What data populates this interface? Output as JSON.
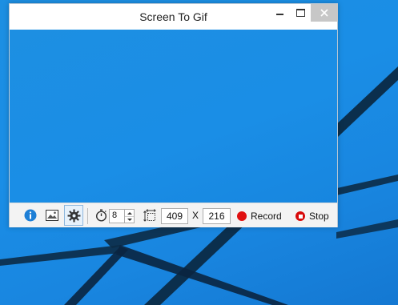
{
  "window": {
    "title": "Screen To Gif"
  },
  "title_buttons": {
    "minimize_icon": "minimize-icon",
    "maximize_icon": "maximize-icon",
    "close_icon": "close-icon"
  },
  "toolbar": {
    "info_icon": "info-icon",
    "image_icon": "image-icon",
    "settings_icon": "gear-icon",
    "timer_icon": "stopwatch-icon",
    "fps_value": "8",
    "size_icon": "resize-icon",
    "width_value": "409",
    "size_separator": "X",
    "height_value": "216",
    "record_label": "Record",
    "stop_label": "Stop"
  },
  "colors": {
    "desktop_blue": "#1a8ee6",
    "record_red": "#e01010",
    "info_blue": "#1e7fd6"
  }
}
